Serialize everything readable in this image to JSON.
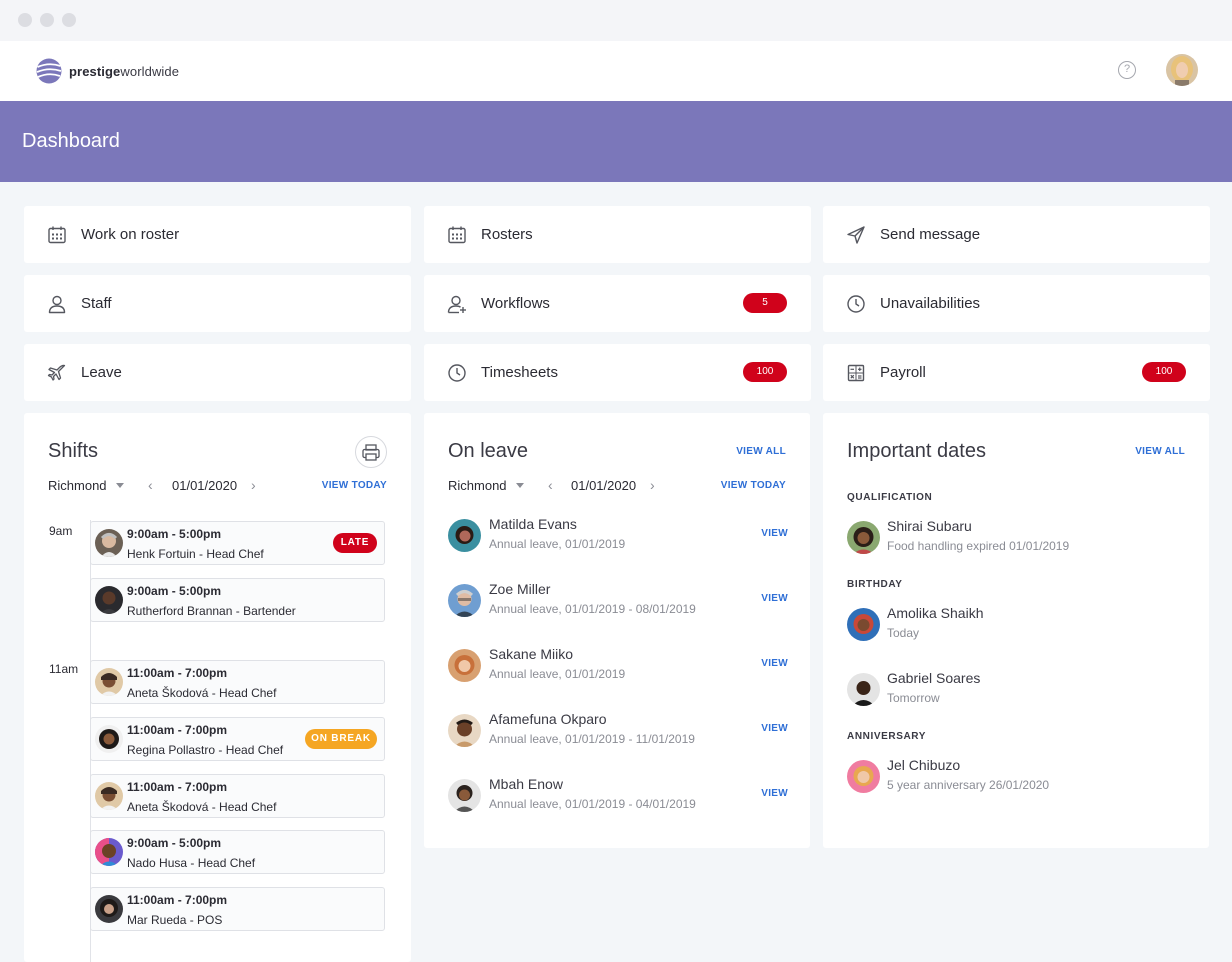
{
  "brand": {
    "name_bold": "prestige",
    "name_rest": "worldwide",
    "accent": "#7b77ba"
  },
  "header": {
    "help_icon": "?"
  },
  "page": {
    "title": "Dashboard"
  },
  "tiles": [
    {
      "label": "Work on roster",
      "icon": "calendar-icon"
    },
    {
      "label": "Rosters",
      "icon": "calendar-icon"
    },
    {
      "label": "Send message",
      "icon": "send-icon"
    },
    {
      "label": "Staff",
      "icon": "user-icon"
    },
    {
      "label": "Workflows",
      "icon": "user-plus-icon",
      "badge": "5"
    },
    {
      "label": "Unavailabilities",
      "icon": "clock-icon"
    },
    {
      "label": "Leave",
      "icon": "plane-icon"
    },
    {
      "label": "Timesheets",
      "icon": "clock-icon",
      "badge": "100"
    },
    {
      "label": "Payroll",
      "icon": "calculator-icon",
      "badge": "100"
    }
  ],
  "shifts": {
    "title": "Shifts",
    "location": "Richmond",
    "date": "01/01/2020",
    "view_today": "VIEW TODAY",
    "time_labels": [
      "9am",
      "11am"
    ],
    "items": [
      {
        "time": "9:00am - 5:00pm",
        "name": "Henk Fortuin - Head Chef",
        "status": "LATE"
      },
      {
        "time": "9:00am - 5:00pm",
        "name": "Rutherford Brannan - Bartender"
      },
      {
        "time": "11:00am - 7:00pm",
        "name": "Aneta Škodová - Head Chef"
      },
      {
        "time": "11:00am - 7:00pm",
        "name": "Regina Pollastro - Head Chef",
        "status": "ON BREAK"
      },
      {
        "time": "11:00am - 7:00pm",
        "name": "Aneta Škodová - Head Chef"
      },
      {
        "time": "9:00am - 5:00pm",
        "name": "Nado Husa - Head Chef"
      },
      {
        "time": "11:00am - 7:00pm",
        "name": "Mar Rueda - POS"
      }
    ]
  },
  "on_leave": {
    "title": "On leave",
    "view_all": "VIEW ALL",
    "location": "Richmond",
    "date": "01/01/2020",
    "view_today": "VIEW TODAY",
    "items": [
      {
        "name": "Matilda Evans",
        "detail": "Annual leave, 01/01/2019",
        "action": "VIEW"
      },
      {
        "name": "Zoe Miller",
        "detail": "Annual leave, 01/01/2019 - 08/01/2019",
        "action": "VIEW"
      },
      {
        "name": "Sakane Miiko",
        "detail": "Annual leave, 01/01/2019",
        "action": "VIEW"
      },
      {
        "name": "Afamefuna Okparo",
        "detail": "Annual leave, 01/01/2019 - 11/01/2019",
        "action": "VIEW"
      },
      {
        "name": "Mbah Enow",
        "detail": "Annual leave, 01/01/2019 - 04/01/2019",
        "action": "VIEW"
      }
    ]
  },
  "important_dates": {
    "title": "Important dates",
    "view_all": "VIEW ALL",
    "groups": [
      {
        "category": "QUALIFICATION",
        "items": [
          {
            "name": "Shirai Subaru",
            "detail": "Food handling expired 01/01/2019"
          }
        ]
      },
      {
        "category": "BIRTHDAY",
        "items": [
          {
            "name": "Amolika Shaikh",
            "detail": "Today"
          },
          {
            "name": "Gabriel Soares",
            "detail": "Tomorrow"
          }
        ]
      },
      {
        "category": "ANNIVERSARY",
        "items": [
          {
            "name": "Jel Chibuzo",
            "detail": "5 year anniversary 26/01/2020"
          }
        ]
      }
    ]
  }
}
